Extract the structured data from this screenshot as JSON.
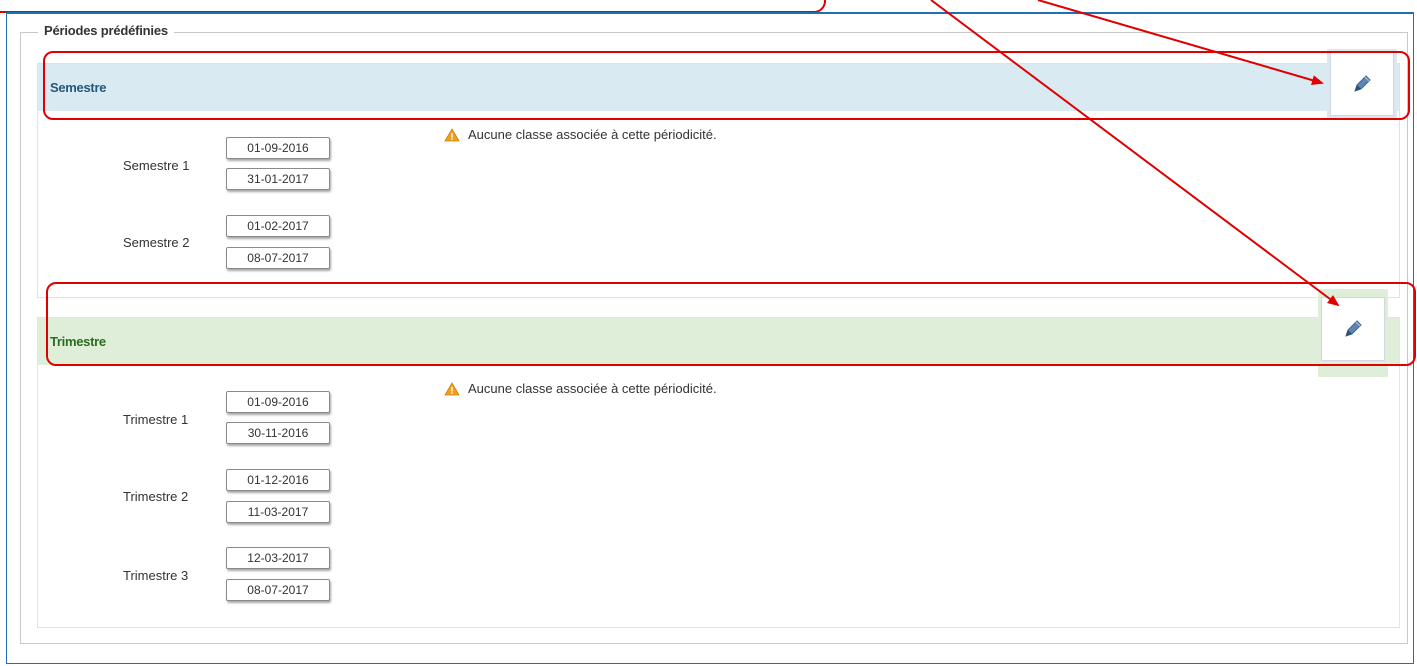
{
  "fieldset": {
    "legend": "Périodes prédéfinies"
  },
  "warning_text": "Aucune classe associée à cette périodicité.",
  "semestre": {
    "title": "Semestre",
    "periods": [
      {
        "label": "Semestre 1",
        "start": "01-09-2016",
        "end": "31-01-2017"
      },
      {
        "label": "Semestre 2",
        "start": "01-02-2017",
        "end": "08-07-2017"
      }
    ]
  },
  "trimestre": {
    "title": "Trimestre",
    "periods": [
      {
        "label": "Trimestre 1",
        "start": "01-09-2016",
        "end": "30-11-2016"
      },
      {
        "label": "Trimestre 2",
        "start": "01-12-2016",
        "end": "11-03-2017"
      },
      {
        "label": "Trimestre 3",
        "start": "12-03-2017",
        "end": "08-07-2017"
      }
    ]
  },
  "icons": {
    "edit": "pencil-icon",
    "warning": "warning-triangle-icon"
  },
  "colors": {
    "semestre_header": "#d9eaf3",
    "trimestre_header": "#dfeed8",
    "annotation_red": "#e00000",
    "frame_blue": "#1f6fb2"
  }
}
